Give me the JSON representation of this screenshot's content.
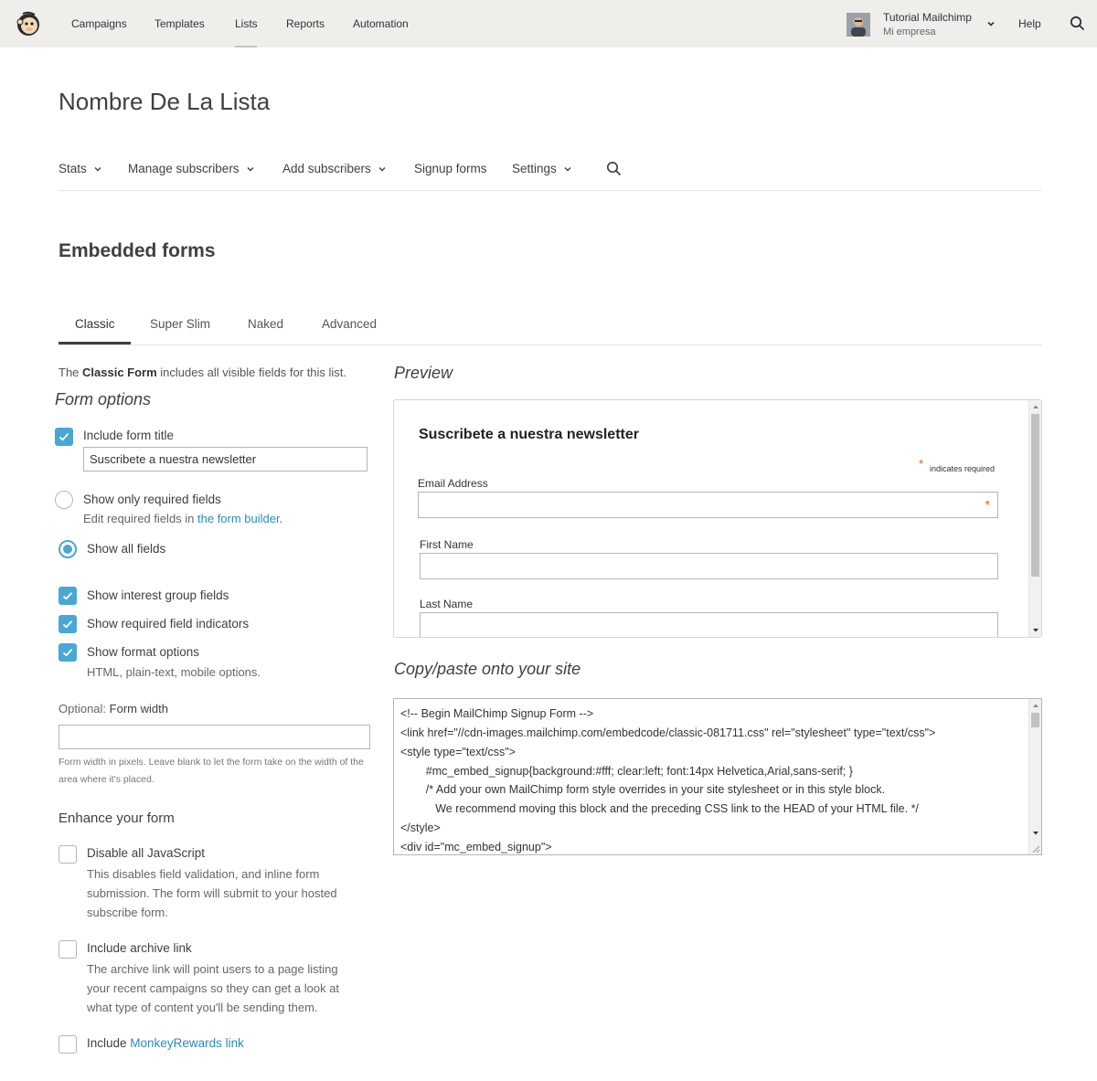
{
  "topnav": {
    "items": [
      "Campaigns",
      "Templates",
      "Lists",
      "Reports",
      "Automation"
    ],
    "active": "Lists",
    "user_name": "Tutorial Mailchimp",
    "user_org": "Mi empresa",
    "help": "Help"
  },
  "page": {
    "title": "Nombre De La Lista"
  },
  "subnav": {
    "stats": "Stats",
    "manage": "Manage subscribers",
    "add": "Add subscribers",
    "signup": "Signup forms",
    "settings": "Settings"
  },
  "section": {
    "title": "Embedded forms"
  },
  "tabs": {
    "items": [
      "Classic",
      "Super Slim",
      "Naked",
      "Advanced"
    ],
    "active": "Classic"
  },
  "left": {
    "desc_prefix": "The ",
    "desc_bold": "Classic Form",
    "desc_suffix": " includes all visible fields for this list.",
    "form_options_heading": "Form options",
    "include_title_label": "Include form title",
    "include_title_checked": true,
    "form_title_value": "Suscribete a nuestra newsletter",
    "show_required_label": "Show only required fields",
    "show_required_selected": false,
    "edit_required_prefix": "Edit required fields in ",
    "edit_required_link": "the form builder",
    "edit_required_suffix": ".",
    "show_all_label": "Show all fields",
    "show_all_selected": true,
    "interest_label": "Show interest group fields",
    "interest_checked": true,
    "indicators_label": "Show required field indicators",
    "indicators_checked": true,
    "format_label": "Show format options",
    "format_checked": true,
    "format_sub": "HTML, plain-text, mobile options.",
    "width_optional": "Optional: ",
    "width_label": "Form width",
    "width_value": "",
    "width_hint": "Form width in pixels. Leave blank to let the form take on the width of the area where it's placed.",
    "enhance_heading": "Enhance your form",
    "disable_js_label": "Disable all JavaScript",
    "disable_js_checked": false,
    "disable_js_sub": "This disables field validation, and inline form submission. The form will submit to your hosted subscribe form.",
    "archive_label": "Include archive link",
    "archive_checked": false,
    "archive_sub": "The archive link will point users to a page listing your recent campaigns so they can get a look at what type of content you'll be sending them.",
    "monkey_prefix": "Include ",
    "monkey_link": "MonkeyRewards link",
    "monkey_checked": false
  },
  "preview": {
    "heading": "Preview",
    "form_title": "Suscribete a nuestra newsletter",
    "required_marker": "*",
    "required_note": "indicates required",
    "email_label": "Email Address",
    "first_name_label": "First Name",
    "last_name_label": "Last Name"
  },
  "code": {
    "heading": "Copy/paste onto your site",
    "lines": [
      "<!-- Begin MailChimp Signup Form -->",
      "<link href=\"//cdn-images.mailchimp.com/embedcode/classic-081711.css\" rel=\"stylesheet\" type=\"text/css\">",
      "<style type=\"text/css\">",
      "        #mc_embed_signup{background:#fff; clear:left; font:14px Helvetica,Arial,sans-serif; }",
      "        /* Add your own MailChimp form style overrides in your site stylesheet or in this style block.",
      "           We recommend moving this block and the preceding CSS link to the HEAD of your HTML file. */",
      "</style>",
      "<div id=\"mc_embed_signup\">"
    ]
  },
  "colors": {
    "accent": "#4aa7d4",
    "link": "#2c8bb9",
    "topbar": "#efeeea",
    "required": "#e85c0d"
  }
}
